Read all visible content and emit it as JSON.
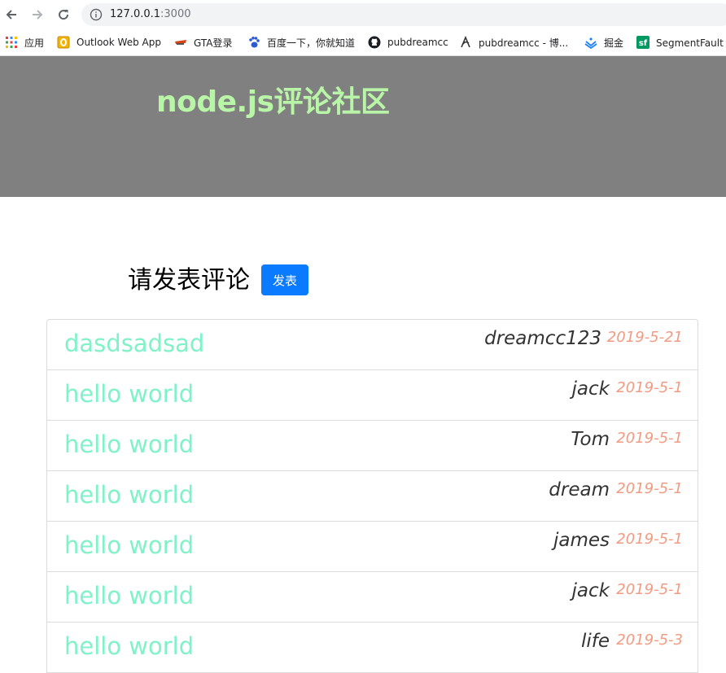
{
  "browser": {
    "url_host": "127.0.0.1",
    "url_port": ":3000",
    "bookmarks": [
      {
        "label": "应用",
        "icon": "apps-grid-icon"
      },
      {
        "label": "Outlook Web App",
        "icon": "outlook-icon"
      },
      {
        "label": "GTA登录",
        "icon": "gta-icon"
      },
      {
        "label": "百度一下，你就知道",
        "icon": "baidu-paw-icon"
      },
      {
        "label": "pubdreamcc",
        "icon": "github-icon"
      },
      {
        "label": "pubdreamcc - 博...",
        "icon": "cnblogs-icon"
      },
      {
        "label": "掘金",
        "icon": "juejin-icon"
      },
      {
        "label": "SegmentFault 思",
        "icon": "segmentfault-icon"
      }
    ]
  },
  "site": {
    "title": "node.js评论社区",
    "compose_label": "请发表评论",
    "publish_label": "发表"
  },
  "comments": [
    {
      "content": "dasdsadsad",
      "name": "dreamcc123",
      "time": "2019-5-21"
    },
    {
      "content": "hello world",
      "name": "jack",
      "time": "2019-5-1"
    },
    {
      "content": "hello world",
      "name": "Tom",
      "time": "2019-5-1"
    },
    {
      "content": "hello world",
      "name": "dream",
      "time": "2019-5-1"
    },
    {
      "content": "hello world",
      "name": "james",
      "time": "2019-5-1"
    },
    {
      "content": "hello world",
      "name": "jack",
      "time": "2019-5-1"
    },
    {
      "content": "hello world",
      "name": "life",
      "time": "2019-5-3"
    }
  ],
  "colors": {
    "header_bg": "#808080",
    "title": "#b8f5a6",
    "publish_button": "#0a7bff",
    "comment_text": "#7ff2c8",
    "comment_time": "#f29b82"
  }
}
